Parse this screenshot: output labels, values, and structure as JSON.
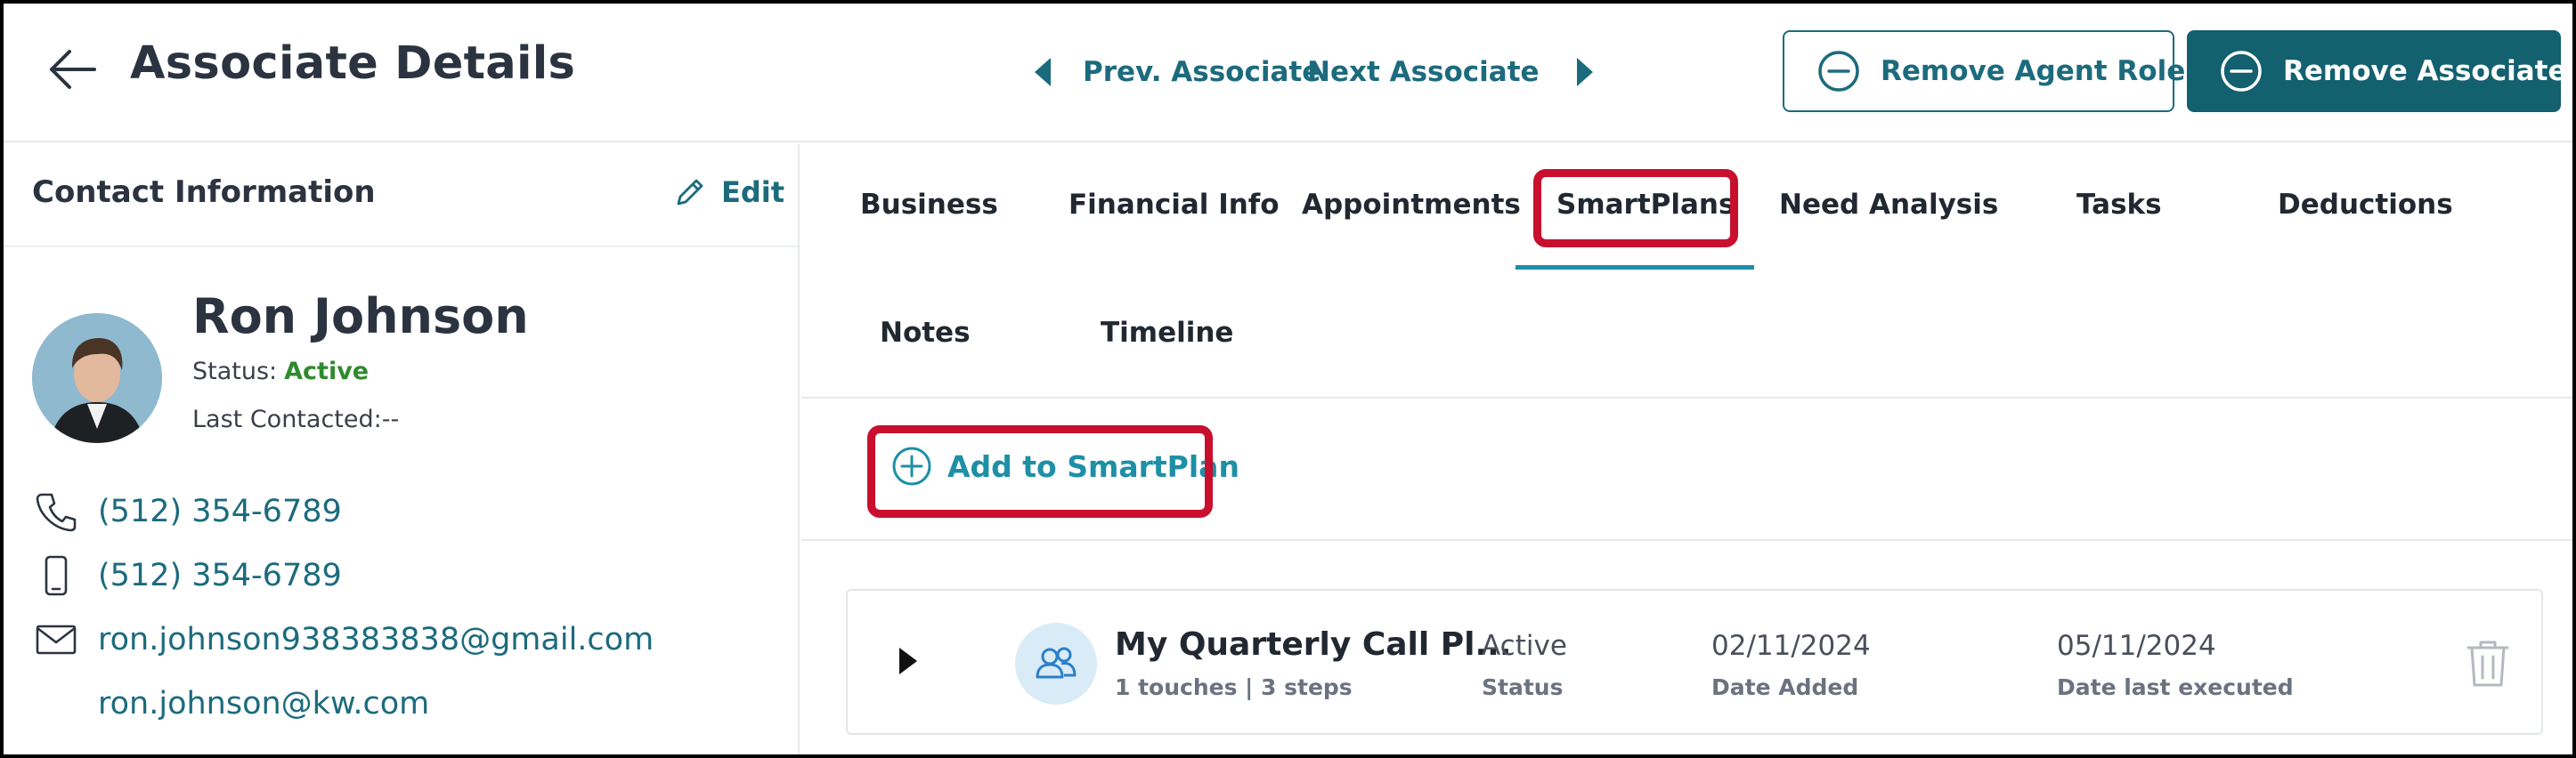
{
  "header": {
    "title": "Associate Details",
    "prev_label": "Prev. Associate",
    "next_label": "Next Associate",
    "remove_agent_role_label": "Remove Agent Role",
    "remove_associate_label": "Remove Associate"
  },
  "contact": {
    "section_title": "Contact Information",
    "edit_label": "Edit",
    "name": "Ron Johnson",
    "status_label": "Status:",
    "status_value": "Active",
    "last_contacted": "Last Contacted:--",
    "phone": "(512) 354-6789",
    "mobile": "(512) 354-6789",
    "email_primary": "ron.johnson938383838@gmail.com",
    "email_secondary": "ron.johnson@kw.com"
  },
  "tabs": [
    {
      "label": "Business"
    },
    {
      "label": "Financial Info"
    },
    {
      "label": "Appointments"
    },
    {
      "label": "SmartPlans",
      "active": true
    },
    {
      "label": "Need Analysis"
    },
    {
      "label": "Tasks"
    },
    {
      "label": "Deductions"
    },
    {
      "label": "Notes"
    },
    {
      "label": "Timeline"
    }
  ],
  "smartplans": {
    "add_label": "Add to SmartPlan",
    "plans": [
      {
        "name": "My Quarterly Call Pl...",
        "meta": "1 touches | 3 steps",
        "status_value": "Active",
        "status_label": "Status",
        "date_added": "02/11/2024",
        "date_added_label": "Date Added",
        "date_last_executed": "05/11/2024",
        "date_last_executed_label": "Date last executed"
      }
    ]
  },
  "colors": {
    "brand_teal": "#1c6b7d",
    "primary_button": "#13606f",
    "active_tab_underline": "#1e8fa6",
    "status_active": "#2f8a2f",
    "highlight_red": "#c8102e"
  },
  "icons": {
    "back": "arrow-left-icon",
    "prev": "caret-left-icon",
    "next": "caret-right-icon",
    "remove": "minus-circle-icon",
    "edit": "pencil-icon",
    "phone": "phone-icon",
    "mobile": "mobile-phone-icon",
    "email": "envelope-icon",
    "add": "plus-circle-icon",
    "expand": "caret-right-icon",
    "plan": "users-icon",
    "delete": "trash-icon"
  }
}
